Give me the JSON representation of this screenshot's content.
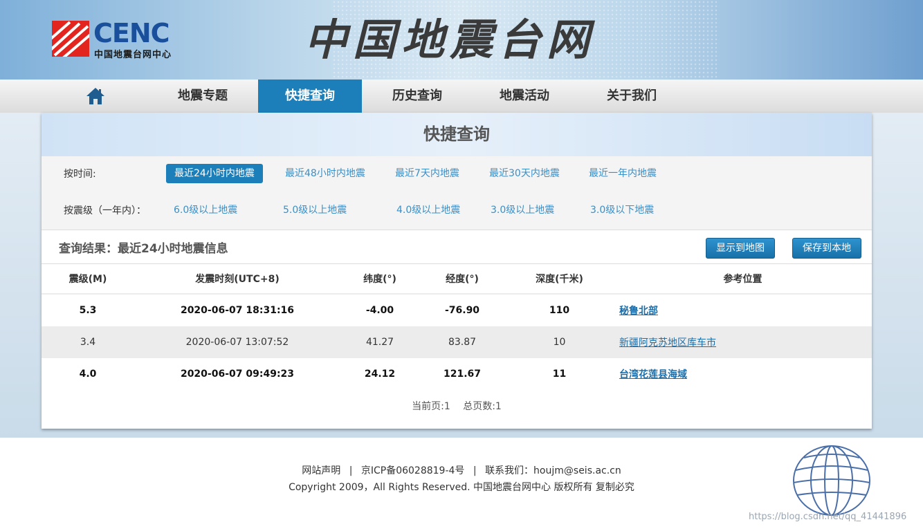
{
  "header": {
    "logo_text": "CENC",
    "logo_sub": "中国地震台网中心",
    "site_title": "中国地震台网"
  },
  "nav": {
    "home_icon": "home-icon",
    "items": [
      {
        "label": "地震专题",
        "active": false
      },
      {
        "label": "快捷查询",
        "active": true
      },
      {
        "label": "历史查询",
        "active": false
      },
      {
        "label": "地震活动",
        "active": false
      },
      {
        "label": "关于我们",
        "active": false
      }
    ]
  },
  "panel": {
    "title": "快捷查询",
    "time_filter": {
      "label": "按时间:",
      "options": [
        "最近24小时内地震",
        "最近48小时内地震",
        "最近7天内地震",
        "最近30天内地震",
        "最近一年内地震"
      ],
      "selected": "最近24小时内地震"
    },
    "magnitude_filter": {
      "label": "按震级（一年内）：",
      "options": [
        "6.0级以上地震",
        "5.0级以上地震",
        "4.0级以上地震",
        "3.0级以上地震",
        "3.0级以下地震"
      ]
    },
    "result_title": "查询结果：最近24小时地震信息",
    "show_map_label": "显示到地图",
    "save_local_label": "保存到本地"
  },
  "table": {
    "headers": [
      "震级(M)",
      "发震时刻(UTC+8)",
      "纬度(°)",
      "经度(°)",
      "深度(千米)",
      "参考位置"
    ],
    "rows": [
      {
        "mag": "5.3",
        "time": "2020-06-07 18:31:16",
        "lat": "-4.00",
        "lon": "-76.90",
        "depth": "110",
        "location": "秘鲁北部",
        "bold": true
      },
      {
        "mag": "3.4",
        "time": "2020-06-07 13:07:52",
        "lat": "41.27",
        "lon": "83.87",
        "depth": "10",
        "location": "新疆阿克苏地区库车市",
        "bold": false
      },
      {
        "mag": "4.0",
        "time": "2020-06-07 09:49:23",
        "lat": "24.12",
        "lon": "121.67",
        "depth": "11",
        "location": "台湾花莲县海域",
        "bold": true
      }
    ]
  },
  "pager": {
    "current": "当前页:1",
    "total": "总页数:1"
  },
  "footer": {
    "statement": "网站声明",
    "icp": "京ICP备06028819-4号",
    "contact": "联系我们：houjm@seis.ac.cn",
    "copyright": "Copyright 2009，All Rights Reserved. 中国地震台网中心 版权所有 复制必究",
    "separator": "|"
  },
  "watermark": "https://blog.csdn.net/qq_41441896",
  "colors": {
    "accent": "#1d7fba",
    "link": "#3a8fc7",
    "logo_red": "#e2251f",
    "logo_blue": "#1a4f9c"
  }
}
